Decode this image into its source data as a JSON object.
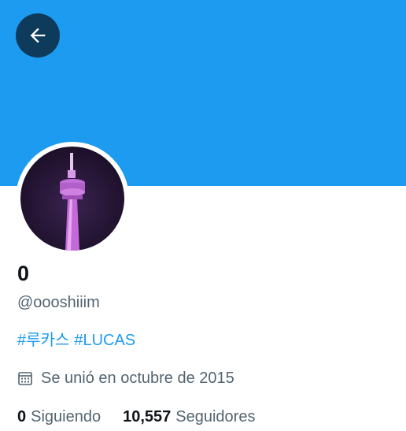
{
  "profile": {
    "display_name": "0",
    "handle": "@oooshiiim",
    "bio_tags": [
      "#루카스",
      "#LUCAS"
    ],
    "joined_text": "Se unió en octubre de 2015",
    "following_count": "0",
    "following_label": "Siguiendo",
    "followers_count": "10,557",
    "followers_label": "Seguidores"
  },
  "icons": {
    "back": "arrow-left-icon",
    "joined": "calendar-icon"
  },
  "colors": {
    "banner": "#1d9bf0",
    "back_button_bg": "#0e3b5c",
    "link": "#1d9bf0",
    "secondary_text": "#536471",
    "primary_text": "#0f1419"
  }
}
